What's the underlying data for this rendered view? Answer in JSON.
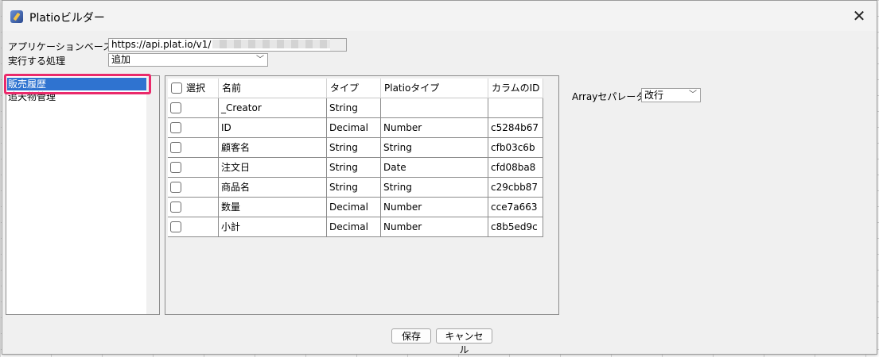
{
  "window": {
    "title": "Platioビルダー"
  },
  "form": {
    "url_label": "アプリケーションベースURL",
    "url_value": "https://api.plat.io/v1/",
    "action_label": "実行する処理",
    "action_value": "追加"
  },
  "tables": [
    "販売履歴",
    "追天物管理"
  ],
  "grid": {
    "headers": [
      "選択",
      "名前",
      "タイプ",
      "Platioタイプ",
      "カラムのID"
    ],
    "rows": [
      {
        "name": "_Creator",
        "type": "String",
        "platio_type": "",
        "column_id": ""
      },
      {
        "name": "ID",
        "type": "Decimal",
        "platio_type": "Number",
        "column_id": "c5284b67"
      },
      {
        "name": "顧客名",
        "type": "String",
        "platio_type": "String",
        "column_id": "cfb03c6b"
      },
      {
        "name": "注文日",
        "type": "String",
        "platio_type": "Date",
        "column_id": "cfd08ba8"
      },
      {
        "name": "商品名",
        "type": "String",
        "platio_type": "String",
        "column_id": "c29cbb87"
      },
      {
        "name": "数量",
        "type": "Decimal",
        "platio_type": "Number",
        "column_id": "cce7a663"
      },
      {
        "name": "小計",
        "type": "Decimal",
        "platio_type": "Number",
        "column_id": "c8b5ed9c"
      }
    ]
  },
  "separator": {
    "label": "Arrayセパレーター",
    "value": "改行"
  },
  "buttons": {
    "save": "保存",
    "cancel": "キャンセル"
  },
  "colors": {
    "selection": "#2f73d0",
    "highlight": "#ea2a6b"
  },
  "icons": {
    "app": "app-icon",
    "close": "close-icon",
    "dropdown": "chevron-down-icon"
  }
}
